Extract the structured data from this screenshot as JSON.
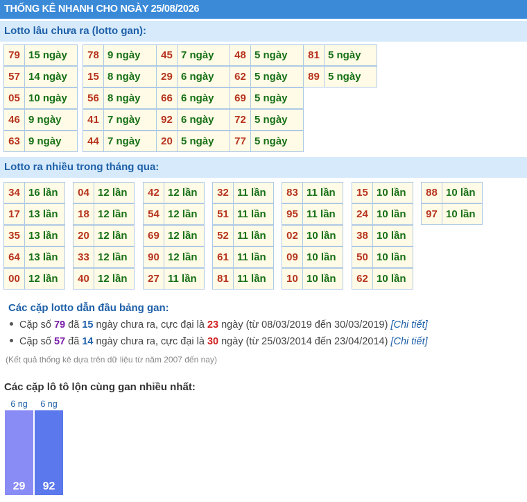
{
  "title": "THỐNG KÊ NHANH CHO NGÀY 25/08/2026",
  "gan_section": {
    "heading": "Lotto lâu chưa ra (lotto gan):",
    "columns": [
      [
        [
          "79",
          "15 ngày"
        ],
        [
          "57",
          "14 ngày"
        ],
        [
          "05",
          "10 ngày"
        ],
        [
          "46",
          "9 ngày"
        ],
        [
          "63",
          "9 ngày"
        ]
      ],
      [
        [
          "78",
          "9 ngày"
        ],
        [
          "15",
          "8 ngày"
        ],
        [
          "56",
          "8 ngày"
        ],
        [
          "41",
          "7 ngày"
        ],
        [
          "44",
          "7 ngày"
        ]
      ],
      [
        [
          "45",
          "7 ngày"
        ],
        [
          "29",
          "6 ngày"
        ],
        [
          "66",
          "6 ngày"
        ],
        [
          "92",
          "6 ngày"
        ],
        [
          "20",
          "5 ngày"
        ]
      ],
      [
        [
          "48",
          "5 ngày"
        ],
        [
          "62",
          "5 ngày"
        ],
        [
          "69",
          "5 ngày"
        ],
        [
          "72",
          "5 ngày"
        ],
        [
          "77",
          "5 ngày"
        ]
      ],
      [
        [
          "81",
          "5 ngày"
        ],
        [
          "89",
          "5 ngày"
        ]
      ]
    ]
  },
  "frequent_section": {
    "heading": "Lotto ra nhiều trong tháng qua:",
    "columns": [
      [
        [
          "34",
          "16 lần"
        ],
        [
          "17",
          "13 lần"
        ],
        [
          "35",
          "13 lần"
        ],
        [
          "64",
          "13 lần"
        ],
        [
          "00",
          "12 lần"
        ]
      ],
      [
        [
          "04",
          "12 lần"
        ],
        [
          "18",
          "12 lần"
        ],
        [
          "20",
          "12 lần"
        ],
        [
          "33",
          "12 lần"
        ],
        [
          "40",
          "12 lần"
        ]
      ],
      [
        [
          "42",
          "12 lần"
        ],
        [
          "54",
          "12 lần"
        ],
        [
          "69",
          "12 lần"
        ],
        [
          "90",
          "12 lần"
        ],
        [
          "27",
          "11 lần"
        ]
      ],
      [
        [
          "32",
          "11 lần"
        ],
        [
          "51",
          "11 lần"
        ],
        [
          "52",
          "11 lần"
        ],
        [
          "61",
          "11 lần"
        ],
        [
          "81",
          "11 lần"
        ]
      ],
      [
        [
          "83",
          "11 lần"
        ],
        [
          "95",
          "11 lần"
        ],
        [
          "02",
          "10 lần"
        ],
        [
          "09",
          "10 lần"
        ],
        [
          "10",
          "10 lần"
        ]
      ],
      [
        [
          "15",
          "10 lần"
        ],
        [
          "24",
          "10 lần"
        ],
        [
          "38",
          "10 lần"
        ],
        [
          "50",
          "10 lần"
        ],
        [
          "62",
          "10 lần"
        ]
      ],
      [
        [
          "88",
          "10 lần"
        ],
        [
          "97",
          "10 lần"
        ]
      ]
    ]
  },
  "leaders": {
    "heading": "Các cặp lotto dẫn đầu bảng gan:",
    "items": [
      {
        "p1": "Cặp số ",
        "num": "79",
        "p2": " đã ",
        "days": "15",
        "p3": " ngày chưa ra, cực đại là ",
        "max": "23",
        "p4": " ngày (từ 08/03/2019 đến 30/03/2019) ",
        "link": "[Chi tiết]"
      },
      {
        "p1": "Cặp số ",
        "num": "57",
        "p2": " đã ",
        "days": "14",
        "p3": " ngày chưa ra, cực đại là ",
        "max": "30",
        "p4": " ngày (từ 25/03/2014 đến 23/04/2014) ",
        "link": "[Chi tiết]"
      }
    ],
    "note": "(Kết quả thống kê dựa trên dữ liệu từ năm 2007 đến nay)"
  },
  "pairs": {
    "heading": "Các cặp lô tô lộn cùng gan nhiều nhất:",
    "bars": [
      {
        "label": "29",
        "top": "6 ng",
        "value": 6,
        "color": "#8a8cf5"
      },
      {
        "label": "92",
        "top": "6 ng",
        "value": 6,
        "color": "#5b78ec"
      }
    ]
  }
}
